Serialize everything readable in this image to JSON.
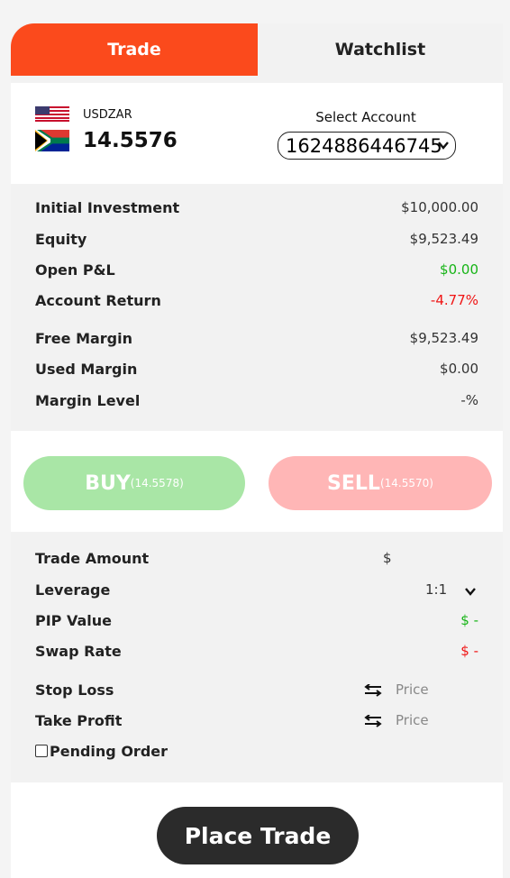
{
  "tabs": {
    "trade": "Trade",
    "watchlist": "Watchlist"
  },
  "colors": {
    "accent": "#fb4a1c",
    "positive": "#16b416",
    "negative": "#f01414",
    "buy": "#a9e6a6",
    "sell": "#ffb6b6"
  },
  "instrument": {
    "symbol": "USDZAR",
    "rate": "14.5576"
  },
  "account": {
    "label": "Select Account",
    "selected": "1624886446745"
  },
  "stats": [
    {
      "label": "Initial Investment",
      "value": "$10,000.00"
    },
    {
      "label": "Equity",
      "value": "$9,523.49"
    },
    {
      "label": "Open P&L",
      "value": "$0.00"
    },
    {
      "label": "Account Return",
      "value": "-4.77%"
    },
    {
      "label": "Free Margin",
      "value": "$9,523.49"
    },
    {
      "label": "Used Margin",
      "value": "$0.00"
    },
    {
      "label": "Margin Level",
      "value": "-%"
    }
  ],
  "buy": {
    "label": "BUY",
    "price": "(14.5578)"
  },
  "sell": {
    "label": "SELL",
    "price": "(14.5570)"
  },
  "form": {
    "trade_amount_label": "Trade Amount",
    "trade_amount_currency": "$",
    "leverage_label": "Leverage",
    "leverage_value": "1:1",
    "pip_value_label": "PIP Value",
    "pip_value": "$ -",
    "swap_rate_label": "Swap Rate",
    "swap_rate": "$ -",
    "stop_loss_label": "Stop Loss",
    "stop_loss_placeholder": "Price",
    "take_profit_label": "Take Profit",
    "take_profit_placeholder": "Price",
    "pending_order_label": "Pending Order"
  },
  "place_trade": "Place Trade",
  "icons": [
    "us-flag-icon",
    "za-flag-icon",
    "chevron-down-icon",
    "swap-arrows-icon"
  ]
}
